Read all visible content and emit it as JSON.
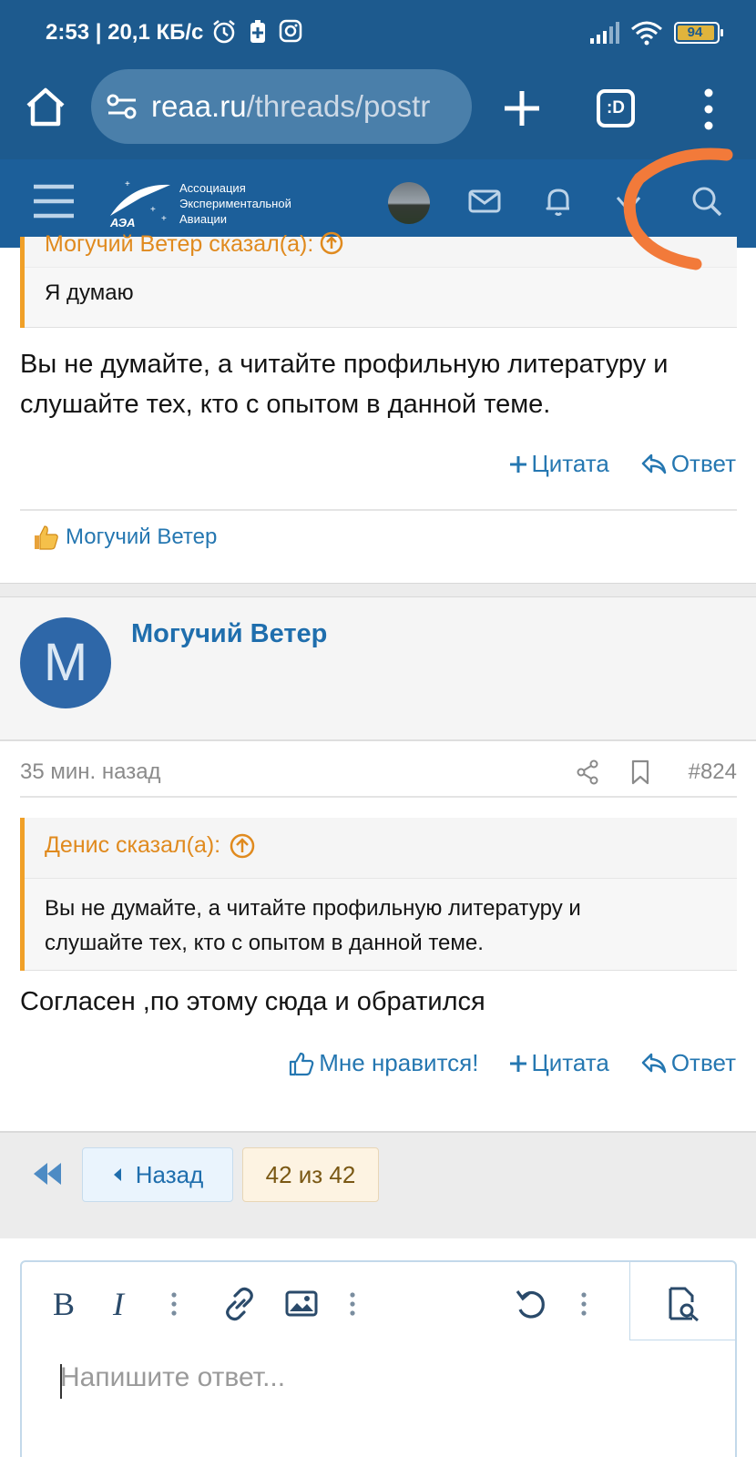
{
  "status_bar": {
    "time": "2:53",
    "speed": "| 20,1 КБ/с",
    "battery": "94"
  },
  "browser": {
    "url_host": "reaa.ru",
    "url_path": "/threads/postr",
    "tabs_label": ":D"
  },
  "site": {
    "logo_line1": "Ассоциация",
    "logo_line2": "Экспериментальной",
    "logo_line3": "Авиации",
    "logo_badge": "АЭА"
  },
  "post1": {
    "quote_author": "Могучий Ветер сказал(а):",
    "quote_text": "Я думаю",
    "text_line1": "Вы не думайте, а читайте профильную литературу и",
    "text_line2": "слушайте тех, кто с опытом в данной теме.",
    "quote_label": "Цитата",
    "reply_label": "Ответ",
    "like_user": "Могучий Ветер"
  },
  "post2": {
    "avatar_letter": "M",
    "username": "Могучий Ветер",
    "time": "35 мин. назад",
    "post_number": "#824",
    "quote_author": "Денис сказал(а):",
    "quote_line1": "Вы не думайте, а читайте профильную литературу и",
    "quote_line2": "слушайте тех, кто с опытом в данной теме.",
    "text": "Согласен ,по этому сюда и обратился",
    "like_label": "Мне нравится!",
    "quote_label": "Цитата",
    "reply_label": "Ответ"
  },
  "pager": {
    "prev_label": "Назад",
    "current": "42 из 42"
  },
  "editor": {
    "placeholder": "Напишите ответ..."
  },
  "colors": {
    "header": "#1c5f9a",
    "link": "#2577b1",
    "quote_accent": "#f0a028",
    "annotation": "#f27a3a"
  }
}
